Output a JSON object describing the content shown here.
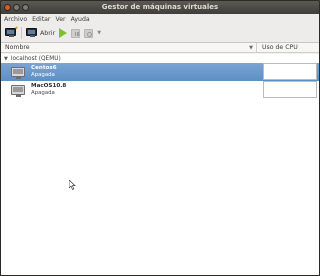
{
  "window": {
    "title": "Gestor de máquinas virtuales"
  },
  "menu": [
    "Archivo",
    "Editar",
    "Ver",
    "Ayuda"
  ],
  "toolbar": {
    "new_icon": "new-vm-icon",
    "open_label": "Abrir",
    "run_icon": "play-icon",
    "pause_icon": "pause-icon",
    "shutdown_icon": "power-icon",
    "dropdown_icon": "chevron-down-icon",
    "play_color": "#7ec12a"
  },
  "columns": {
    "name": "Nombre",
    "cpu": "Uso de CPU"
  },
  "connection": {
    "label": "localhost (QEMU)"
  },
  "vms": [
    {
      "name": "Centos6",
      "status": "Apagada",
      "selected": true
    },
    {
      "name": "MacOS10.8",
      "status": "Apagada",
      "selected": false
    }
  ],
  "colors": {
    "selection": "#5e8fc4",
    "titlebar": "#3f3e3a"
  }
}
